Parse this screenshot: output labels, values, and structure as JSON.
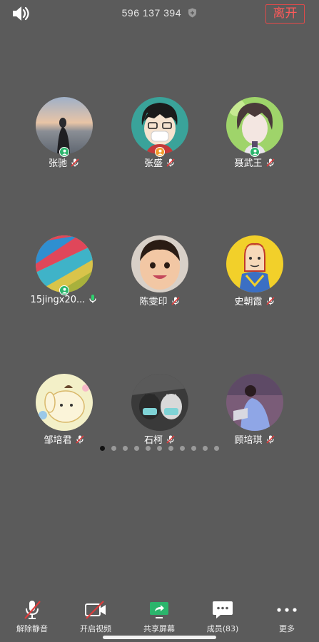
{
  "header": {
    "speaker_icon": "speaker-icon",
    "meeting_id": "596 137 394",
    "shield_icon": "shield-icon",
    "leave_label": "离开",
    "leave_color": "#ff5a5a"
  },
  "participants": [
    {
      "name": "张驰",
      "badge": "green",
      "mic": "muted"
    },
    {
      "name": "张盛",
      "badge": "orange",
      "mic": "muted"
    },
    {
      "name": "聂武王",
      "badge": "green",
      "mic": "muted"
    },
    {
      "name": "15jingx20...",
      "badge": "green",
      "mic": "on"
    },
    {
      "name": "陈雯印",
      "badge": "",
      "mic": "muted"
    },
    {
      "name": "史朝霞",
      "badge": "",
      "mic": "muted"
    },
    {
      "name": "邹培君",
      "badge": "",
      "mic": "muted"
    },
    {
      "name": "石柯",
      "badge": "",
      "mic": "muted"
    },
    {
      "name": "顾培琪",
      "badge": "",
      "mic": "muted"
    }
  ],
  "pager": {
    "total": 11,
    "active": 1
  },
  "toolbar": {
    "unmute": "解除静音",
    "video": "开启视频",
    "share": "共享屏幕",
    "members": "成员(83)",
    "more": "更多"
  },
  "colors": {
    "background": "#5b5b5b",
    "badge_green": "#2bb56c",
    "badge_orange": "#f29b2b",
    "mic_on": "#2fd06e",
    "muted_red": "#e03b3b"
  }
}
